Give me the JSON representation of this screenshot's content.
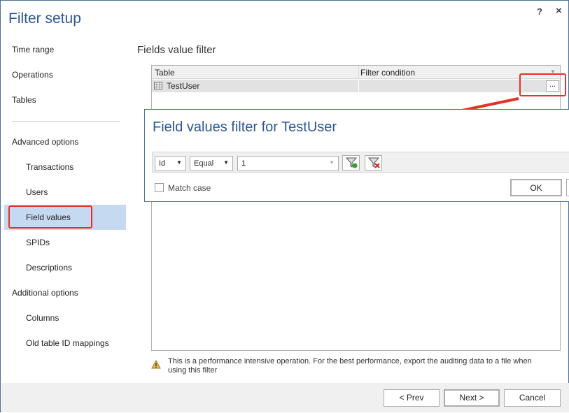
{
  "window": {
    "title": "Filter setup",
    "help": "?",
    "close": "×"
  },
  "sidebar": {
    "items": [
      {
        "label": "Time range"
      },
      {
        "label": "Operations"
      },
      {
        "label": "Tables"
      },
      {
        "label": "Advanced options"
      },
      {
        "label": "Transactions"
      },
      {
        "label": "Users"
      },
      {
        "label": "Field values",
        "selected": true
      },
      {
        "label": "SPIDs"
      },
      {
        "label": "Descriptions"
      },
      {
        "label": "Additional options"
      },
      {
        "label": "Columns"
      },
      {
        "label": "Old table ID mappings"
      }
    ]
  },
  "main": {
    "heading": "Fields value filter",
    "grid": {
      "columns": [
        "Table",
        "Filter condition"
      ],
      "rows": [
        {
          "table": "TestUser",
          "condition": ""
        }
      ],
      "ellipsis": "..."
    },
    "warning": "This is a performance intensive operation. For the best performance, export the auditing data to a file when using this filter"
  },
  "popup": {
    "title": "Field values filter for TestUser",
    "field": "Id",
    "operator": "Equal",
    "value": "1",
    "match_case": "Match case",
    "match_case_checked": false,
    "ok": "OK"
  },
  "footer": {
    "prev": "< Prev",
    "next": "Next >",
    "cancel": "Cancel"
  },
  "colors": {
    "accent": "#2b5797",
    "selection": "#c5d9f1",
    "annotation": "#e8302a"
  }
}
